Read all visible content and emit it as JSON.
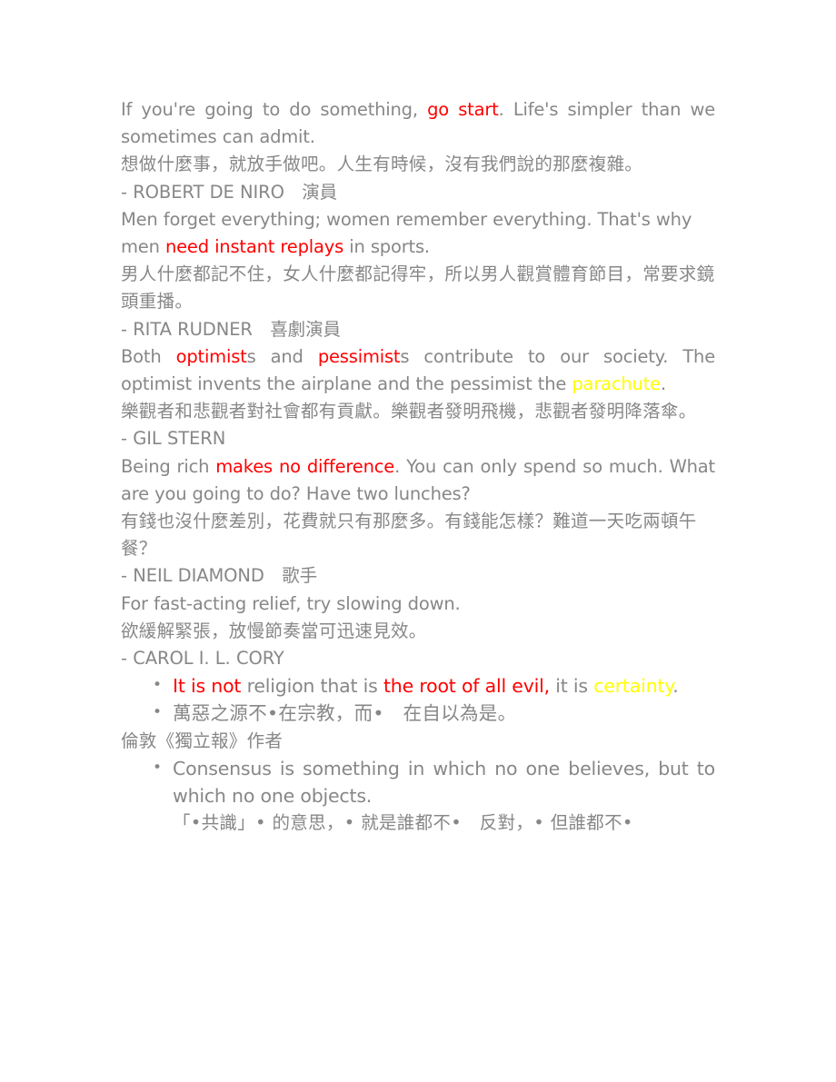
{
  "document": {
    "text_color": "#878787",
    "highlight_red": "#ff0000",
    "highlight_yellow": "#ffff00",
    "background": "#ffffff"
  },
  "quotes": [
    {
      "id": "de-niro",
      "english_pre": "If you're going to do something, ",
      "english_red": "go start",
      "english_post": ". Life's simpler than we sometimes can admit.",
      "chinese": "想做什麼事，就放手做吧。人生有時候，沒有我們說的那麼複雜。",
      "attribution": "- ROBERT DE NIRO　演員"
    },
    {
      "id": "rudner",
      "english_pre": "Men forget everything; women remember everything. That's why men ",
      "english_red": "need instant replays",
      "english_post": " in sports.",
      "chinese": "男人什麼都記不住，女人什麼都記得牢，所以男人觀賞體育節目，常要求鏡頭重播。",
      "attribution": "- RITA RUDNER　喜劇演員"
    },
    {
      "id": "gil-stern",
      "english_seg_1": "Both ",
      "english_red_1": "optimist",
      "english_seg_2": "s and ",
      "english_red_2": "pessimist",
      "english_seg_3": "s contribute to our society. The optimist invents the airplane and the pessimist the ",
      "english_yellow": "parachute",
      "english_seg_4": ".",
      "chinese": "樂觀者和悲觀者對社會都有貢獻。樂觀者發明飛機，悲觀者發明降落傘。",
      "attribution": "- GIL STERN"
    },
    {
      "id": "neil-diamond",
      "english_pre": "Being rich ",
      "english_red": "makes no difference",
      "english_post": ". You can only spend so much. What are you going to do? Have two lunches?",
      "chinese": "有錢也沒什麼差別，花費就只有那麼多。有錢能怎樣？難道一天吃兩頓午餐？",
      "attribution": "- NEIL DIAMOND　歌手"
    },
    {
      "id": "carol-cory",
      "english": "For fast-acting relief, try slowing down.",
      "chinese": "欲緩解緊張，放慢節奏當可迅速見效。",
      "attribution": "- CAROL I. L. CORY"
    }
  ],
  "bullet_group_1": {
    "item_en_red_1": "It is not",
    "item_en_mid_1": " religion that is ",
    "item_en_red_2": "the root of all evil,",
    "item_en_mid_2": " it is ",
    "item_en_yellow": "certainty",
    "item_en_end": ".",
    "item_zh": "萬惡之源不•在宗教，而•　在自以為是。"
  },
  "source_line": "倫敦《獨立報》作者",
  "bullet_group_2": {
    "item_en": "Consensus is something in which no one believes, but to which no one objects.",
    "item_zh": "「•共識」• 的意思，• 就是誰都不•　反對，• 但誰都不•"
  }
}
